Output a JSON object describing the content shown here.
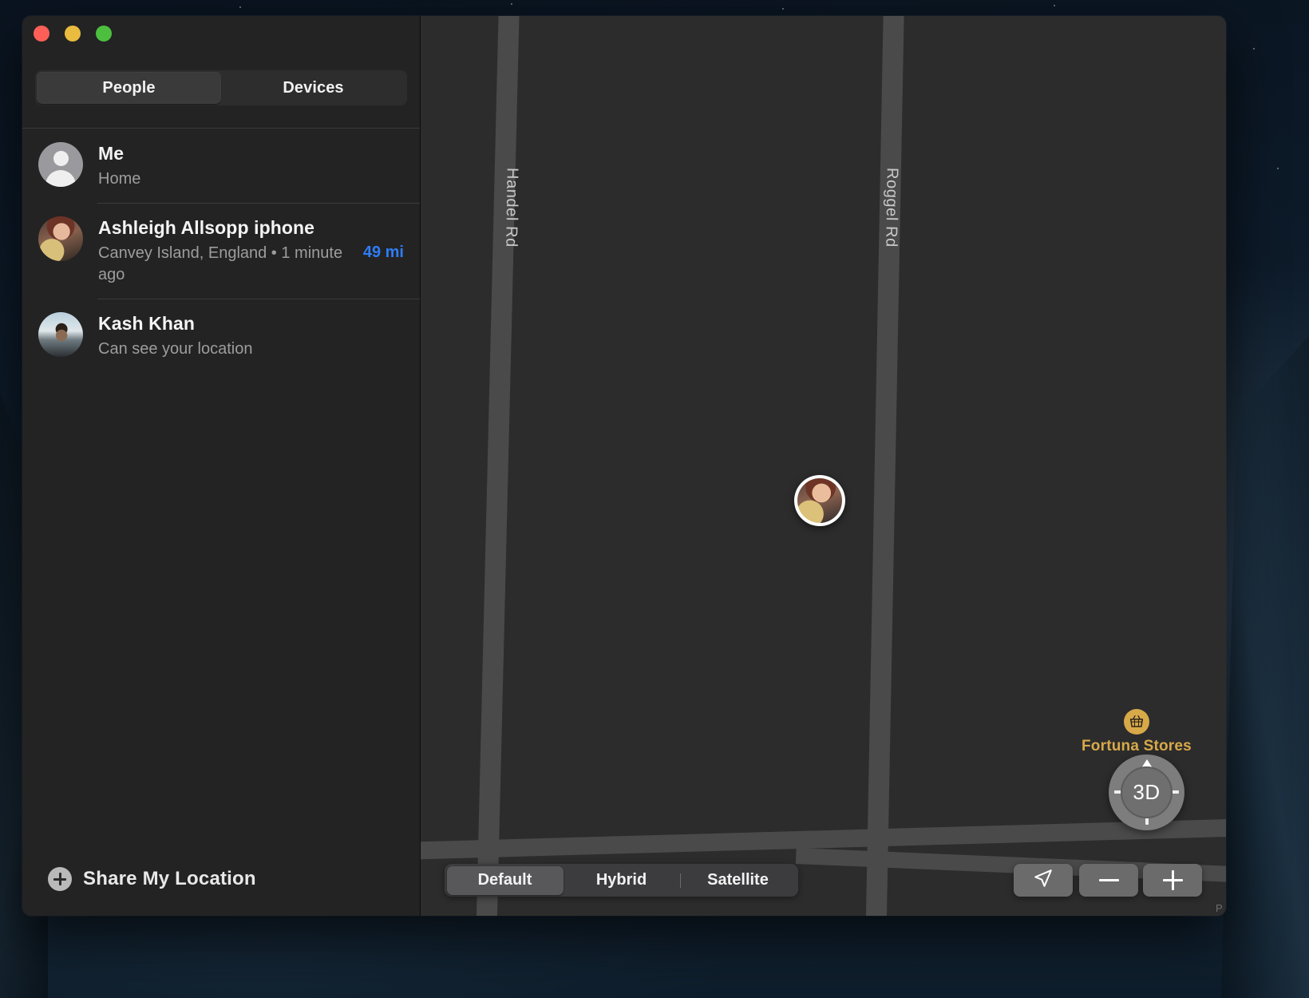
{
  "window": {
    "traffic_lights": [
      {
        "name": "close",
        "color": "#ff5f57"
      },
      {
        "name": "minimize",
        "color": "#e9bb3f"
      },
      {
        "name": "maximize",
        "color": "#4dbf3f"
      }
    ]
  },
  "sidebar": {
    "tabs": [
      {
        "label": "People",
        "active": true
      },
      {
        "label": "Devices",
        "active": false
      }
    ],
    "people": [
      {
        "name": "Me",
        "subtitle": "Home",
        "distance": "",
        "avatar": "generic-person-icon"
      },
      {
        "name": "Ashleigh Allsopp iphone",
        "subtitle": "Canvey Island, England • 1 minute ago",
        "distance": "49 mi",
        "avatar": "photo-avatar-ashleigh"
      },
      {
        "name": "Kash Khan",
        "subtitle": "Can see your location",
        "distance": "",
        "avatar": "photo-avatar-kash"
      }
    ],
    "footer": {
      "label": "Share My Location",
      "icon": "plus-circle-icon"
    }
  },
  "map": {
    "road_labels": [
      "Handel Rd",
      "Roggel Rd"
    ],
    "poi": {
      "label": "Fortuna Stores",
      "icon": "shopping-basket-icon",
      "color": "#d8a949"
    },
    "pin": {
      "name": "ashleigh-location-pin"
    },
    "map_type_segments": [
      {
        "label": "Default",
        "active": true
      },
      {
        "label": "Hybrid",
        "active": false
      },
      {
        "label": "Satellite",
        "active": false
      }
    ],
    "controls": {
      "dial_label": "3D",
      "locate_icon": "locate-arrow-icon",
      "zoom_out_icon": "minus-icon",
      "zoom_in_icon": "plus-icon"
    },
    "watermark": "P"
  },
  "colors": {
    "accent_blue": "#2f7cf6",
    "poi_gold": "#d8a949",
    "sidebar_bg": "#232323",
    "map_bg": "#2c2c2c"
  }
}
